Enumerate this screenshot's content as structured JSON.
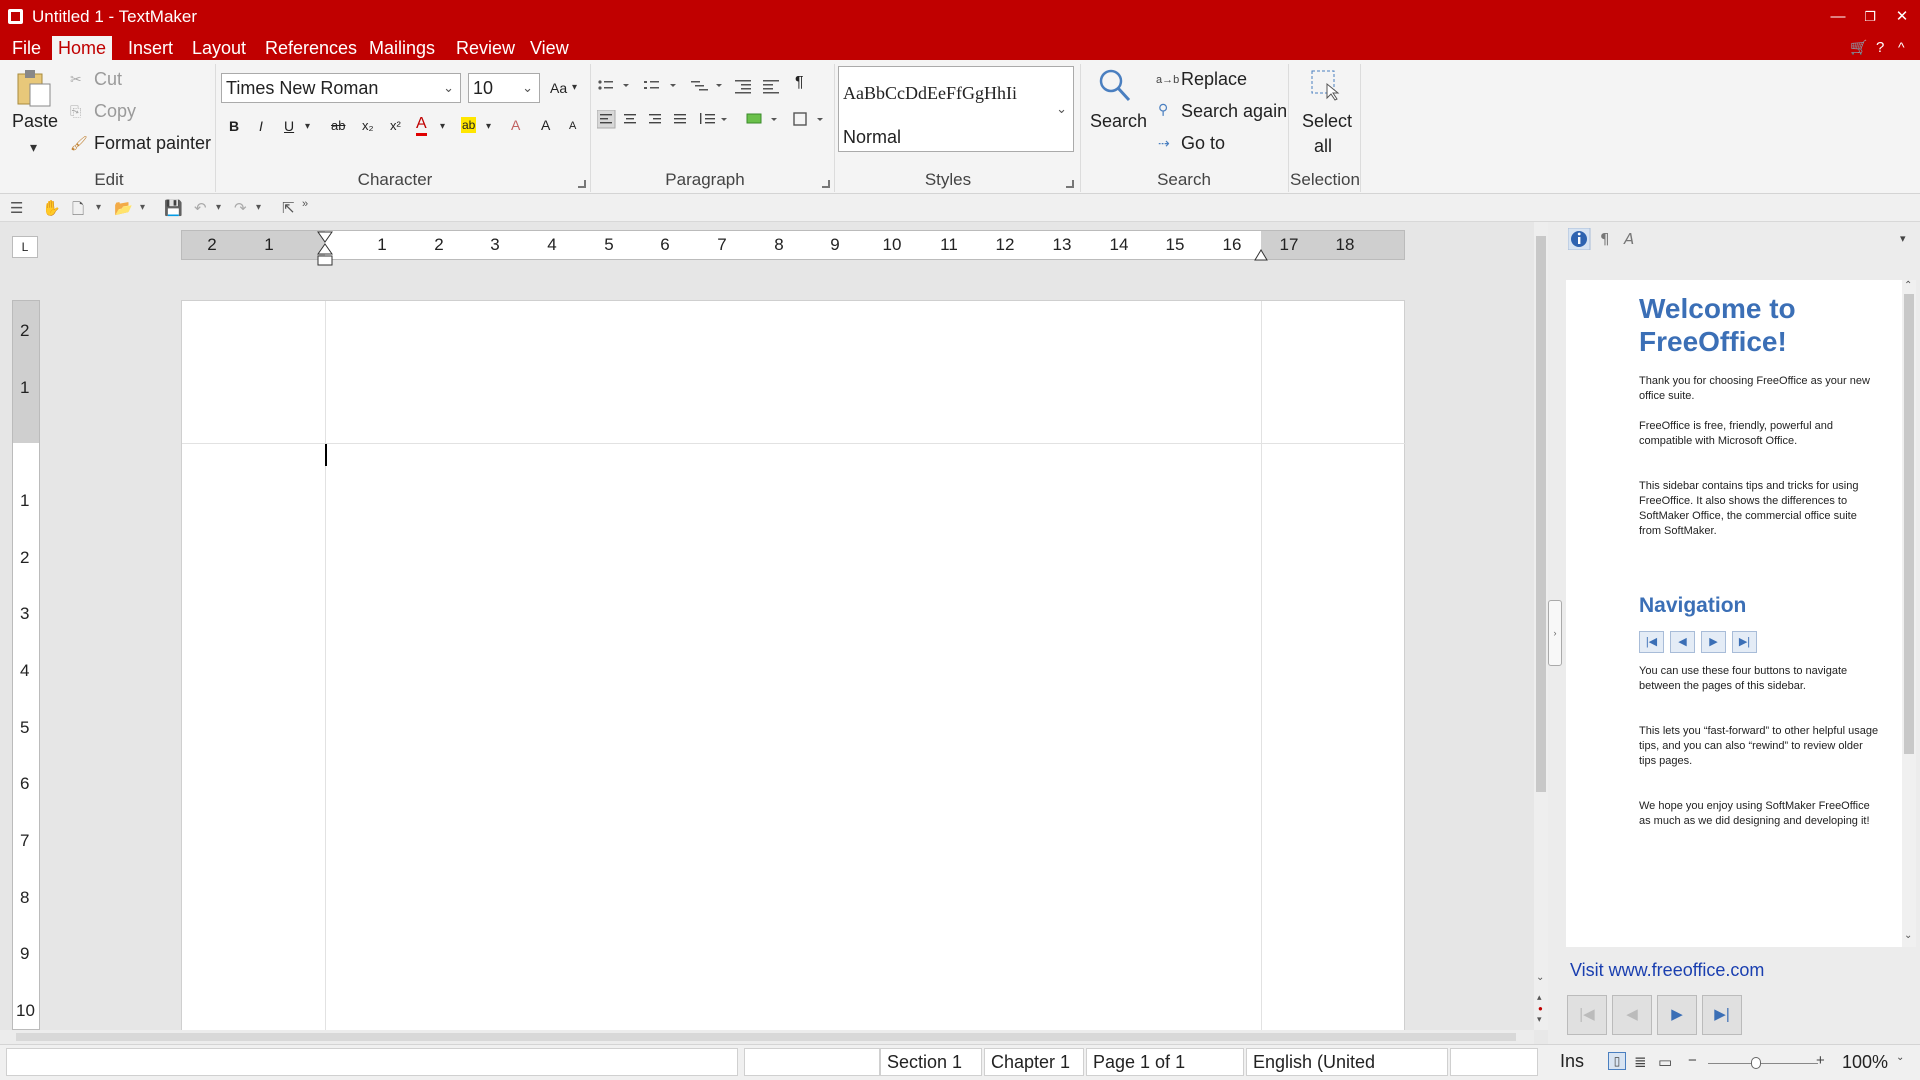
{
  "window": {
    "title": "Untitled 1 - TextMaker",
    "minimize": "—",
    "restore": "❐",
    "close": "✕"
  },
  "menu": {
    "items": [
      "File",
      "Home",
      "Insert",
      "Layout",
      "References",
      "Mailings",
      "Review",
      "View"
    ],
    "active": "Home"
  },
  "ribbon": {
    "edit": {
      "paste": "Paste",
      "cut": "Cut",
      "copy": "Copy",
      "format_painter": "Format painter",
      "label": "Edit"
    },
    "character": {
      "font": "Times New Roman",
      "size": "10",
      "bold": "B",
      "italic": "I",
      "underline": "U",
      "strike": "ab",
      "subscript": "x₂",
      "superscript": "x²",
      "font_color_glyph": "A",
      "highlight_glyph": "ab",
      "clear_format": "A",
      "grow": "A",
      "shrink": "A",
      "case_glyph": "Aa",
      "label": "Character"
    },
    "paragraph": {
      "pilcrow": "¶",
      "label": "Paragraph"
    },
    "styles": {
      "sample": "AaBbCcDdEeFfGgHhIi",
      "current": "Normal",
      "label": "Styles"
    },
    "search": {
      "search": "Search",
      "replace": "Replace",
      "search_again": "Search again",
      "goto": "Go to",
      "replace_glyph": "a→b",
      "label": "Search"
    },
    "selection": {
      "select": "Select",
      "all": "all",
      "label": "Selection"
    }
  },
  "ruler": {
    "h_left": [
      "2",
      "1"
    ],
    "h_right": [
      "1",
      "2",
      "3",
      "4",
      "5",
      "6",
      "7",
      "8",
      "9",
      "10",
      "11",
      "12",
      "13",
      "14",
      "15",
      "16",
      "17",
      "18"
    ],
    "v_top": [
      "2",
      "1"
    ],
    "v_body": [
      "1",
      "2",
      "3",
      "4",
      "5",
      "6",
      "7",
      "8",
      "9",
      "10"
    ],
    "tab_glyph": "L"
  },
  "sidebar": {
    "welcome_title": "Welcome to FreeOffice!",
    "p1": "Thank you for choosing FreeOffice as your new office suite.",
    "p2": "FreeOffice is free, friendly, powerful and compatible with Microsoft Office.",
    "p3": "This sidebar contains tips and tricks for using FreeOffice. It also shows the differences to SoftMaker Office, the commercial office suite from SoftMaker.",
    "nav_title": "Navigation",
    "p4": "You can use these four buttons to navigate between the pages of this sidebar.",
    "p5": "This lets you “fast-forward” to other helpful usage tips, and you can also “rewind” to review older tips pages.",
    "p6": "We hope you enjoy using SoftMaker FreeOffice as much as we did designing and developing it!",
    "link": "Visit www.freeoffice.com",
    "nav_first": "|◀",
    "nav_prev": "◀",
    "nav_next": "▶",
    "nav_last": "▶|"
  },
  "status": {
    "section": "Section 1",
    "chapter": "Chapter 1",
    "page": "Page 1 of 1",
    "language": "English (United",
    "mode": "Ins",
    "zoom": "100%",
    "zoom_minus": "−",
    "zoom_plus": "+"
  }
}
